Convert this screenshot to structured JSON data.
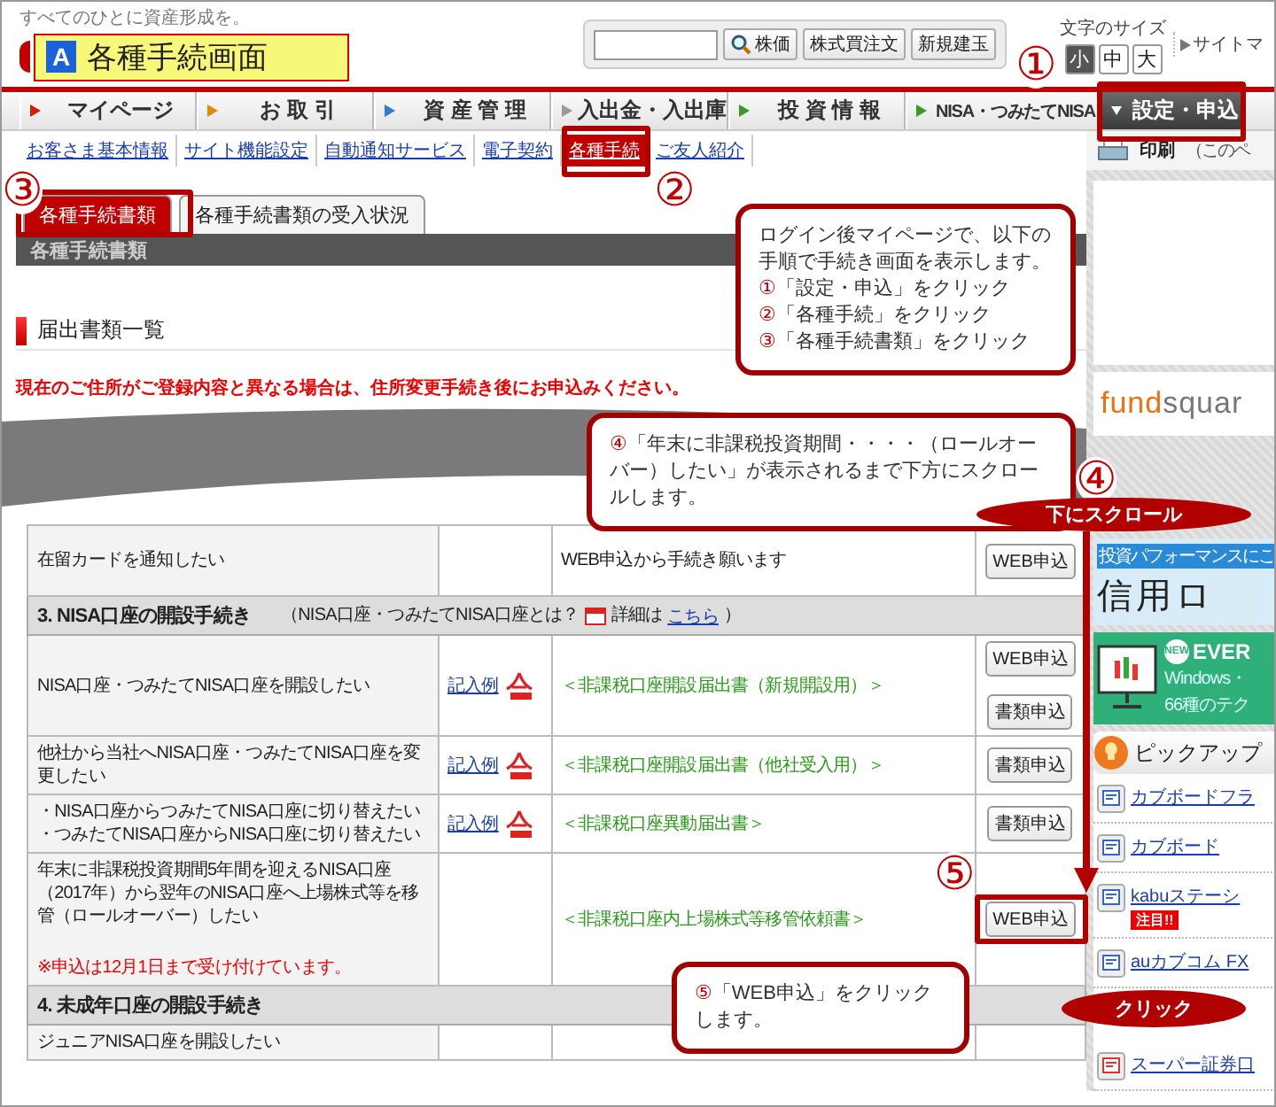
{
  "header": {
    "tagline": "すべてのひとに資産形成を。",
    "screen_label": {
      "badge": "A",
      "title": "各種手続画面"
    },
    "quick_buttons": [
      "株価",
      "株式買注文",
      "新規建玉"
    ],
    "font_size": {
      "label": "文字のサイズ",
      "options": [
        {
          "label": "小",
          "selected": true
        },
        {
          "label": "中",
          "selected": false
        },
        {
          "label": "大",
          "selected": false
        }
      ]
    },
    "sitemap_link": "サイトマ"
  },
  "nav": [
    {
      "label": "マイページ",
      "selected": false,
      "color": "#cc2200"
    },
    {
      "label": "お 取 引",
      "selected": false,
      "color": "#e08a00"
    },
    {
      "label": "資 産 管 理",
      "selected": false,
      "color": "#2a7fd0"
    },
    {
      "label": "入出金・入出庫",
      "selected": false
    },
    {
      "label": "投 資 情 報",
      "selected": false,
      "color": "#3a9a20"
    },
    {
      "label": "NISA・つみたてNISA",
      "selected": false,
      "color": "#3a9a20"
    },
    {
      "label": "設定・申込",
      "selected": true
    }
  ],
  "subnav": {
    "items": [
      {
        "label": "お客さま基本情報",
        "selected": false
      },
      {
        "label": "サイト機能設定",
        "selected": false
      },
      {
        "label": "自動通知サービス",
        "selected": false
      },
      {
        "label": "電子契約",
        "selected": false
      },
      {
        "label": "各種手続",
        "selected": true
      },
      {
        "label": "ご友人紹介",
        "selected": false
      }
    ]
  },
  "print": {
    "label": "印刷",
    "note": "（このペ"
  },
  "tabs": [
    {
      "label": "各種手続書類",
      "selected": true
    },
    {
      "label": "各種手続書類の受入状況",
      "selected": false
    }
  ],
  "panel_title": "各種手続書類",
  "section_title": "届出書類一覧",
  "notice": "現在のご住所がご登録内容と異なる場合は、住所変更手続き後にお申込みください。",
  "table": {
    "rows": [
      {
        "kind": "item",
        "lines": [
          "在留カードを通知したい"
        ],
        "instruction": "WEB申込から手続き願います",
        "buttons": [
          "WEB申込"
        ]
      },
      {
        "kind": "section",
        "title": "3. NISA口座の開設手続き",
        "aside": "（NISA口座・つみたてNISA口座とは？",
        "link_prefix": "詳細は",
        "link": "こちら",
        "aside_end": "）"
      },
      {
        "kind": "item",
        "lines": [
          "NISA口座・つみたてNISA口座を開設したい"
        ],
        "example": "記入例",
        "form": "＜非課税口座開設届出書（新規開設用）＞",
        "buttons": [
          "WEB申込",
          "書類申込"
        ]
      },
      {
        "kind": "item",
        "lines": [
          "他社から当社へNISA口座・つみたてNISA口座を変更したい"
        ],
        "example": "記入例",
        "form": "＜非課税口座開設届出書（他社受入用）＞",
        "buttons": [
          "書類申込"
        ]
      },
      {
        "kind": "item",
        "lines": [
          "・NISA口座からつみたてNISA口座に切り替えたい",
          "・つみたてNISA口座からNISA口座に切り替えたい"
        ],
        "example": "記入例",
        "form": "＜非課税口座異動届出書＞",
        "buttons": [
          "書類申込"
        ]
      },
      {
        "kind": "item",
        "lines": [
          "年末に非課税投資期間5年間を迎えるNISA口座（2017年）から翌年のNISA口座へ上場株式等を移管（ロールオーバー）したい"
        ],
        "note": "※申込は12月1日まで受け付けています。",
        "form": "＜非課税口座内上場株式等移管依頼書＞",
        "buttons": [
          "WEB申込"
        ]
      },
      {
        "kind": "section",
        "title": "4. 未成年口座の開設手続き"
      },
      {
        "kind": "item",
        "lines": [
          "ジュニアNISA口座を開設したい"
        ]
      }
    ]
  },
  "sidebar": {
    "ads": [
      {
        "kind": "logo",
        "parts": [
          "fund",
          "squar"
        ]
      },
      {
        "kind": "robo",
        "tagline": "投資パフォーマンスにこ",
        "title": "信用ロ"
      },
      {
        "kind": "tool",
        "badge": "NEW",
        "title": "EVER",
        "lines": [
          "Windows・",
          "66種のテク"
        ]
      }
    ],
    "pickup": {
      "title": "ピックアップ",
      "links": [
        {
          "label": "カブボードフラ"
        },
        {
          "label": "カブボード"
        },
        {
          "label": "kabuステーシ",
          "badge": "注目!!"
        },
        {
          "label": "auカブコム FX"
        },
        {
          "label": "スーパー証券口"
        }
      ]
    }
  },
  "annotations": {
    "markers": [
      "①",
      "②",
      "③",
      "④",
      "⑤"
    ],
    "callouts": [
      {
        "kind": "steps",
        "intro": "ログイン後マイページで、以下の手順で手続き画面を表示します。",
        "steps": [
          {
            "mark": "①",
            "text": "「設定・申込」をクリック"
          },
          {
            "mark": "②",
            "text": "「各種手続」をクリック"
          },
          {
            "mark": "③",
            "text": "「各種手続書類」をクリック"
          }
        ]
      },
      {
        "kind": "note",
        "mark": "④",
        "text": "「年末に非課税投資期間・・・・（ロールオーバー）したい」が表示されるまで下方にスクロールします。"
      },
      {
        "kind": "note",
        "mark": "⑤",
        "text": "「WEB申込」をクリックします。"
      }
    ],
    "pills": [
      "下にスクロール",
      "クリック"
    ]
  }
}
